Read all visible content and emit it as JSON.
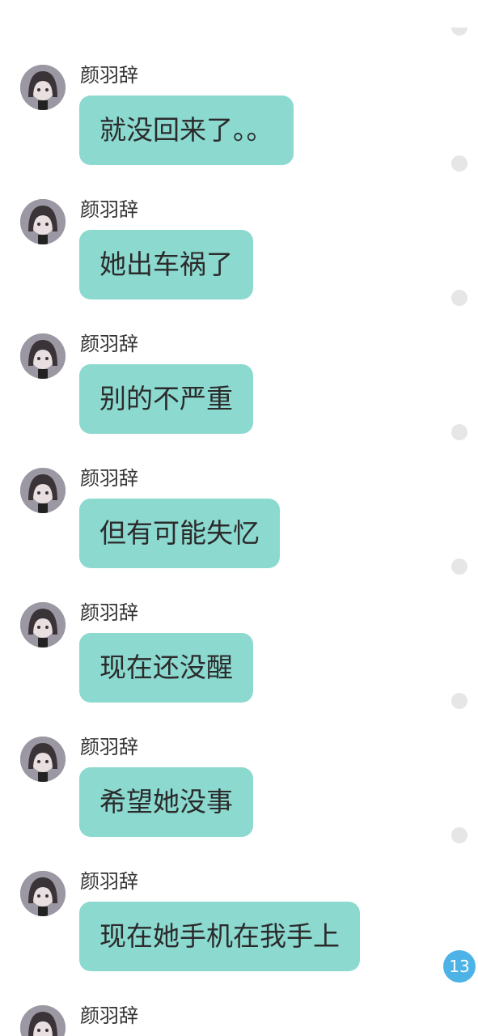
{
  "conversation": {
    "messages": [
      {
        "sender": "颜羽辞",
        "text": "就没回来了。。"
      },
      {
        "sender": "颜羽辞",
        "text": "她出车祸了"
      },
      {
        "sender": "颜羽辞",
        "text": "别的不严重"
      },
      {
        "sender": "颜羽辞",
        "text": "但有可能失忆"
      },
      {
        "sender": "颜羽辞",
        "text": "现在还没醒"
      },
      {
        "sender": "颜羽辞",
        "text": "希望她没事"
      },
      {
        "sender": "颜羽辞",
        "text": "现在她手机在我手上"
      },
      {
        "sender": "颜羽辞",
        "text": ""
      }
    ],
    "bubble_color": "#8cd9d0",
    "status_dot_color": "#e6e6e6"
  },
  "unread_badge": {
    "count": "13",
    "color": "#4db3e6"
  }
}
